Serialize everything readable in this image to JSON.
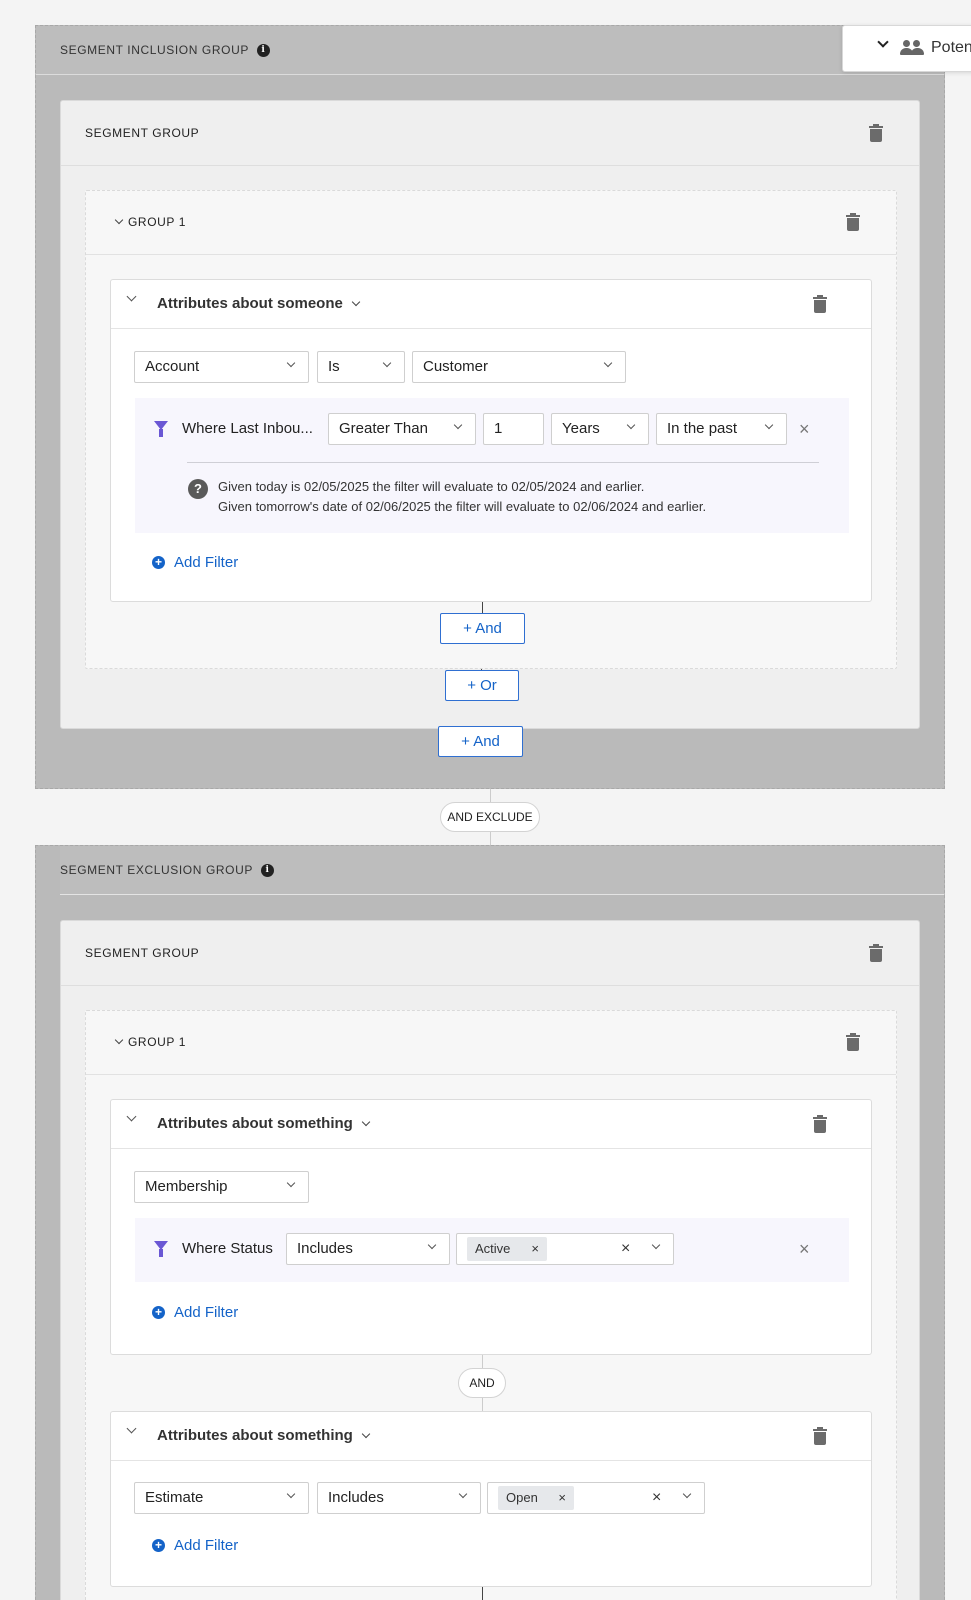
{
  "top_popover": {
    "label": "Poten"
  },
  "inclusion": {
    "title": "SEGMENT INCLUSION GROUP",
    "segment_group_title": "SEGMENT GROUP",
    "group_title": "GROUP 1",
    "card": {
      "title": "Attributes about someone",
      "object_select": "Account",
      "operator_select": "Is",
      "value_select": "Customer",
      "filter": {
        "label": "Where Last Inbou...",
        "operator": "Greater Than",
        "amount": "1",
        "unit": "Years",
        "direction": "In the past",
        "hint_line1": "Given today is 02/05/2025 the filter will evaluate to 02/05/2024 and earlier.",
        "hint_line2": "Given tomorrow's date of 02/06/2025 the filter will evaluate to 02/06/2024 and earlier."
      },
      "add_filter": "Add Filter"
    },
    "and_inner": "+ And",
    "or_button": "+ Or",
    "and_outer": "+ And"
  },
  "and_exclude": "AND EXCLUDE",
  "exclusion": {
    "title": "SEGMENT EXCLUSION GROUP",
    "segment_group_title": "SEGMENT GROUP",
    "group_title": "GROUP 1",
    "card1": {
      "title": "Attributes about something",
      "object_select": "Membership",
      "filter": {
        "label": "Where Status",
        "operator": "Includes",
        "chip": "Active"
      },
      "add_filter": "Add Filter"
    },
    "and_pill": "AND",
    "card2": {
      "title": "Attributes about something",
      "object_select": "Estimate",
      "operator_select": "Includes",
      "chip": "Open",
      "add_filter": "Add Filter"
    }
  },
  "icons": {
    "remove": "×",
    "question": "?",
    "info": "i"
  }
}
